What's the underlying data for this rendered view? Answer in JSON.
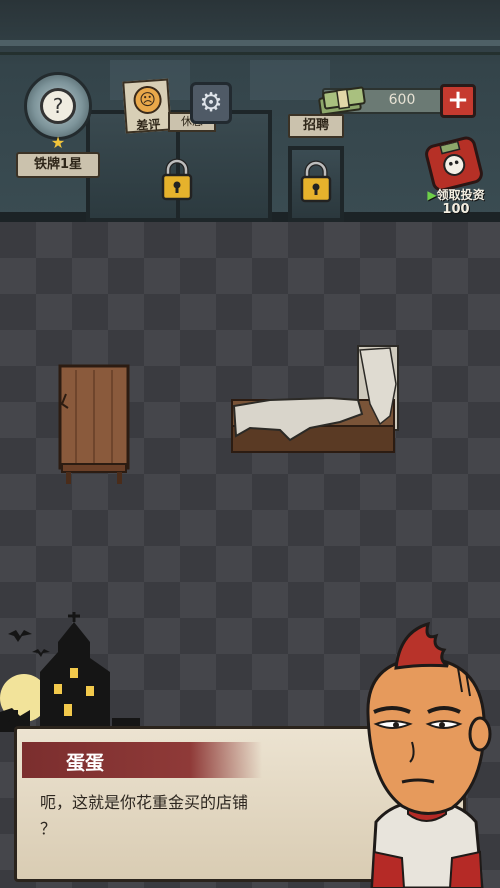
{
  "hud": {
    "rank_label": "铁牌1星",
    "review_label": "差评",
    "money_amount": "600",
    "recruit_label": "招聘",
    "invest_label": "领取投资",
    "invest_count": "100",
    "partial_sign_text": "休息"
  },
  "dialog": {
    "speaker": "蛋蛋",
    "line1": "呃，这就是你花重金买的店铺",
    "line2": "？"
  },
  "colors": {
    "accent_red": "#c63a2f",
    "banner_red": "#8f3a38",
    "dialog_bg": "#e6dcc6"
  }
}
